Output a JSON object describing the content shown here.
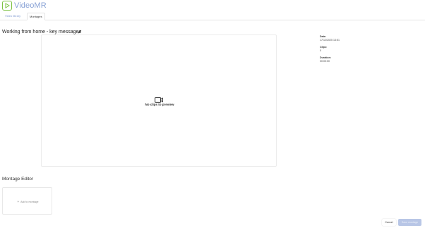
{
  "app": {
    "name": "VideoMR",
    "brand_color": "#7cc242",
    "logo_text_color": "#8aa3d6"
  },
  "tabs": [
    {
      "label": "Video library",
      "active": false
    },
    {
      "label": "Montages",
      "active": true
    }
  ],
  "montage": {
    "title": "Working from home - key messages",
    "preview_empty_text": "No clips to preview"
  },
  "meta": {
    "date_label": "Date:",
    "date_value": "17/12/2025 13:51",
    "clips_label": "Clips:",
    "clips_value": "0",
    "duration_label": "Duration:",
    "duration_value": "00:00:00"
  },
  "editor": {
    "title": "Montage Editor",
    "add_label": "Add to montage"
  },
  "actions": {
    "cancel_label": "Cancel",
    "save_label": "Save montage",
    "save_enabled": false
  },
  "icons": {
    "logo": "play-icon",
    "edit": "pencil-icon",
    "preview": "video-camera-icon",
    "add": "plus-icon"
  }
}
